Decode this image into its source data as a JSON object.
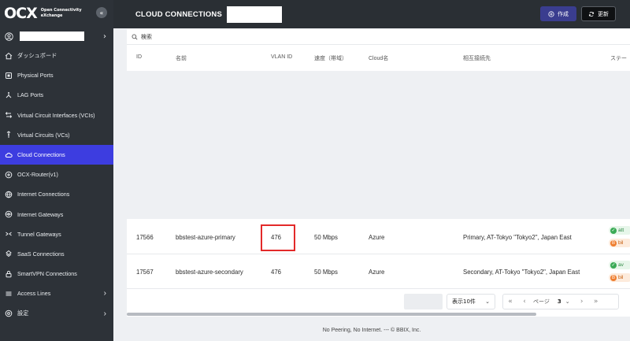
{
  "brand": {
    "logo": "OCX",
    "line1": "Open Connectivity",
    "line2": "eXchange",
    "collapse_glyph": "«"
  },
  "sidebar": {
    "user_chevron": "›",
    "items": [
      {
        "label": "ダッシュボード",
        "icon": "home-icon"
      },
      {
        "label": "Physical Ports",
        "icon": "port-icon"
      },
      {
        "label": "LAG Ports",
        "icon": "lag-icon"
      },
      {
        "label": "Virtual Circuit Interfaces (VCIs)",
        "icon": "vci-icon"
      },
      {
        "label": "Virtual Circuits (VCs)",
        "icon": "vc-icon"
      },
      {
        "label": "Cloud Connections",
        "icon": "cloud-icon",
        "active": true
      },
      {
        "label": "OCX-Router(v1)",
        "icon": "router-icon"
      },
      {
        "label": "Internet Connections",
        "icon": "internet-icon"
      },
      {
        "label": "Internet Gateways",
        "icon": "gateway-icon"
      },
      {
        "label": "Tunnel Gateways",
        "icon": "tunnel-icon"
      },
      {
        "label": "SaaS Connections",
        "icon": "saas-icon"
      },
      {
        "label": "SmartVPN Connections",
        "icon": "vpn-icon"
      },
      {
        "label": "Access Lines",
        "icon": "access-lines-icon",
        "chevron": "›"
      },
      {
        "label": "設定",
        "icon": "settings-icon",
        "chevron": "›"
      }
    ]
  },
  "header": {
    "title": "CLOUD CONNECTIONS",
    "create_label": "作成",
    "refresh_label": "更新"
  },
  "search": {
    "placeholder": "検索"
  },
  "table": {
    "columns": [
      "ID",
      "名前",
      "VLAN ID",
      "速度（帯域）",
      "Cloud名",
      "相互接続先",
      "ステー"
    ],
    "rows": [
      {
        "id": "17566",
        "name": "bbstest-azure-primary",
        "vlan": "476",
        "speed": "50 Mbps",
        "cloud": "Azure",
        "peer": "Primary, AT-Tokyo \"Tokyo2\", Japan East",
        "badge1": "att",
        "badge2": "bil"
      },
      {
        "id": "17567",
        "name": "bbstest-azure-secondary",
        "vlan": "476",
        "speed": "50 Mbps",
        "cloud": "Azure",
        "peer": "Secondary, AT-Tokyo \"Tokyo2\", Japan East",
        "badge1": "av",
        "badge2": "bil"
      }
    ]
  },
  "pagination": {
    "per_page": "表示10件",
    "page_label": "ページ",
    "current_page": "3",
    "first": "«",
    "prev": "‹",
    "next": "›",
    "last": "»",
    "caret": "⌄"
  },
  "footer": {
    "text": "No Peering, No Internet. --- © BBIX, Inc."
  },
  "colors": {
    "sidebar_bg": "#2d3238",
    "active_item": "#3d3de0",
    "topbar_bg": "#2a2f34",
    "create_btn": "#3a3d8f",
    "highlight_border": "#e32929"
  }
}
